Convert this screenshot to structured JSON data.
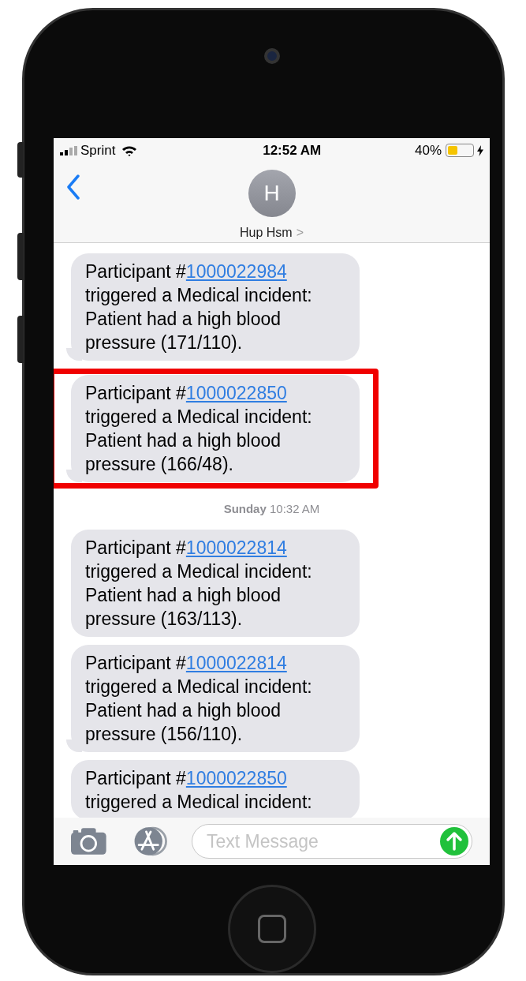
{
  "status_bar": {
    "carrier": "Sprint",
    "time": "12:52 AM",
    "battery": "40%",
    "charging": true
  },
  "header": {
    "avatar_initial": "H",
    "contact_name": "Hup Hsm",
    "chevron": ">"
  },
  "thread": [
    {
      "kind": "message",
      "prefix": "Participant #",
      "link": "1000022984",
      "body": "triggered a Medical incident: Patient had a high blood pressure (171/110).",
      "highlighted": false,
      "tail": true
    },
    {
      "kind": "message",
      "prefix": "Participant #",
      "link": "1000022850",
      "body": "triggered a Medical incident: Patient had a high blood pressure (166/48).",
      "highlighted": true,
      "tail": true
    },
    {
      "kind": "timestamp",
      "day": "Sunday",
      "time": "10:32 AM"
    },
    {
      "kind": "message",
      "prefix": "Participant #",
      "link": "1000022814",
      "body": "triggered a Medical incident: Patient had a high blood pressure (163/113).",
      "highlighted": false,
      "tail": false
    },
    {
      "kind": "message",
      "prefix": "Participant #",
      "link": "1000022814",
      "body": "triggered a Medical incident: Patient had a high blood pressure (156/110).",
      "highlighted": false,
      "tail": true
    },
    {
      "kind": "message",
      "prefix": "Participant #",
      "link": "1000022850",
      "body": "triggered a Medical incident:",
      "highlighted": false,
      "tail": false
    }
  ],
  "compose": {
    "placeholder": "Text Message"
  }
}
